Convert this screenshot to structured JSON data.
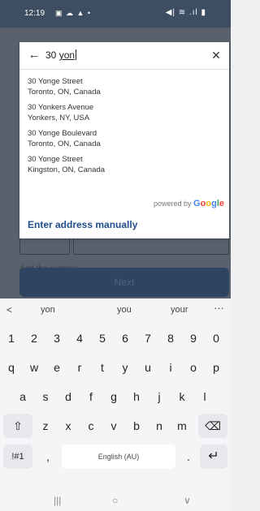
{
  "status_bar": {
    "time": "12:19",
    "left_icons": "▣ ☁ ▲ •",
    "right_icons": "◀| ≋ .ıl ▮"
  },
  "search": {
    "value": "30 yon",
    "prefix": "30 ",
    "typed": "yon"
  },
  "suggestions": [
    {
      "line1": "30 Yonge Street",
      "line2": "Toronto, ON, Canada"
    },
    {
      "line1": "30 Yonkers Avenue",
      "line2": "Yonkers, NY, USA"
    },
    {
      "line1": "30 Yonge Boulevard",
      "line2": "Toronto, ON, Canada"
    },
    {
      "line1": "30 Yonge Street",
      "line2": "Kingston, ON, Canada"
    }
  ],
  "powered_by": "powered by",
  "google": [
    "G",
    "o",
    "o",
    "g",
    "l",
    "e"
  ],
  "manual_label": "Enter address manually",
  "background": {
    "hint_label": "Add the number",
    "next_label": "Next"
  },
  "keyboard": {
    "suggestions": [
      "yon",
      "you",
      "your"
    ],
    "more": "···",
    "back": "<",
    "numbers": [
      "1",
      "2",
      "3",
      "4",
      "5",
      "6",
      "7",
      "8",
      "9",
      "0"
    ],
    "row_q": [
      "q",
      "w",
      "e",
      "r",
      "t",
      "y",
      "u",
      "i",
      "o",
      "p"
    ],
    "row_a": [
      "a",
      "s",
      "d",
      "f",
      "g",
      "h",
      "j",
      "k",
      "l"
    ],
    "row_z": [
      "z",
      "x",
      "c",
      "v",
      "b",
      "n",
      "m"
    ],
    "shift": "⇧",
    "backspace": "⌫",
    "symbols": "!#1",
    "comma": ",",
    "space_label": "English (AU)",
    "period": ".",
    "enter": "↵"
  },
  "nav": {
    "recent": "|||",
    "home": "○",
    "back": "∨"
  }
}
